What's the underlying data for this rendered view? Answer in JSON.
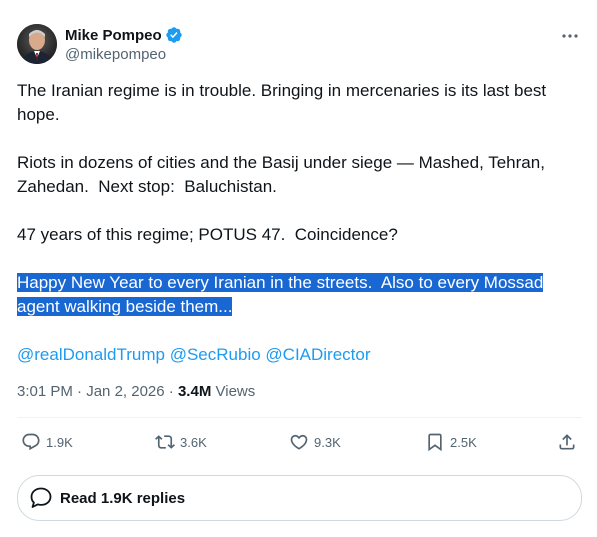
{
  "author": {
    "name": "Mike Pompeo",
    "handle": "@mikepompeo",
    "verified": true
  },
  "tweet": {
    "paragraphs": [
      "The Iranian regime is in trouble. Bringing in mercenaries is its last best hope.",
      "Riots in dozens of cities and the Basij under siege — Mashed, Tehran, Zahedan.  Next stop:  Baluchistan.",
      "47 years of this regime; POTUS 47.  Coincidence?"
    ],
    "selected_paragraph": {
      "line1": "Happy New Year to every Iranian in the streets.  Also to every Mossad",
      "line2": "agent walking beside them..."
    },
    "mentions": [
      "@realDonaldTrump",
      "@SecRubio",
      "@CIADirector"
    ]
  },
  "meta": {
    "time": "3:01 PM",
    "date": "Jan 2, 2026",
    "views_count": "3.4M",
    "views_label": "Views",
    "separator": "·"
  },
  "actions": {
    "replies": "1.9K",
    "reposts": "3.6K",
    "likes": "9.3K",
    "bookmarks": "2.5K"
  },
  "read_replies": "Read 1.9K replies",
  "colors": {
    "accent": "#1d9bf0",
    "selection": "#1967d2",
    "secondary_text": "#536471"
  },
  "icons": [
    "verified-badge-icon",
    "more-options-icon",
    "reply-icon",
    "repost-icon",
    "like-icon",
    "bookmark-icon",
    "share-icon",
    "speech-bubble-icon"
  ]
}
